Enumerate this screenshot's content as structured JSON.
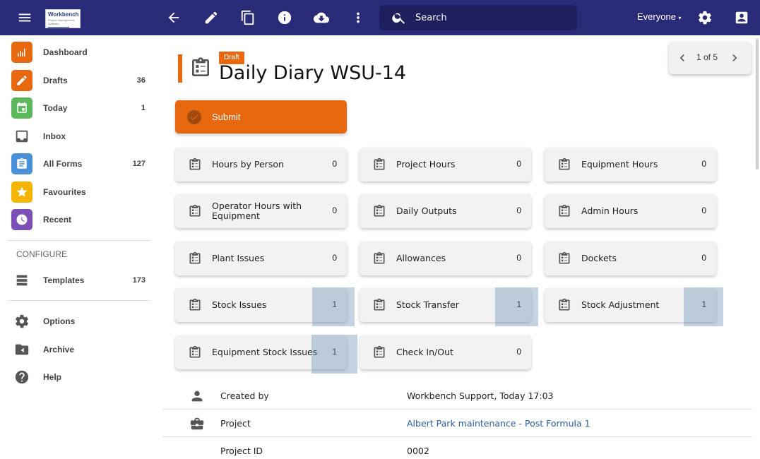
{
  "app": {
    "logo_text": "Workbench",
    "logo_subtext": "Project Management Software"
  },
  "topbar": {
    "search_placeholder": "Search",
    "filter_label": "Everyone"
  },
  "sidebar": {
    "items": [
      {
        "label": "Dashboard",
        "count": "",
        "icon": "dashboard-icon",
        "color": "#e8680f"
      },
      {
        "label": "Drafts",
        "count": "36",
        "icon": "pencil-icon",
        "color": "#e8680f"
      },
      {
        "label": "Today",
        "count": "1",
        "icon": "calendar-icon",
        "color": "#5cb85c"
      },
      {
        "label": "Inbox",
        "count": "",
        "icon": "inbox-icon",
        "color": ""
      },
      {
        "label": "All Forms",
        "count": "127",
        "icon": "clipboard-icon",
        "color": "#4a90d9"
      },
      {
        "label": "Favourites",
        "count": "",
        "icon": "star-icon",
        "color": "#f4b400"
      },
      {
        "label": "Recent",
        "count": "",
        "icon": "clock-icon",
        "color": "#7b4fb5"
      }
    ],
    "configure_label": "CONFIGURE",
    "configure_items": [
      {
        "label": "Templates",
        "count": "173",
        "icon": "templates-icon"
      }
    ],
    "bottom_items": [
      {
        "label": "Options",
        "icon": "gear-icon"
      },
      {
        "label": "Archive",
        "icon": "archive-icon"
      },
      {
        "label": "Help",
        "icon": "help-icon"
      }
    ]
  },
  "form": {
    "status_badge": "Draft",
    "title": "Daily Diary WSU-14",
    "pager_text": "1 of 5",
    "submit_label": "Submit"
  },
  "tiles": [
    {
      "label": "Hours by Person",
      "count": "0",
      "highlighted": false
    },
    {
      "label": "Project Hours",
      "count": "0",
      "highlighted": false
    },
    {
      "label": "Equipment Hours",
      "count": "0",
      "highlighted": false
    },
    {
      "label": "Operator Hours with Equipment",
      "count": "0",
      "highlighted": false
    },
    {
      "label": "Daily Outputs",
      "count": "0",
      "highlighted": false
    },
    {
      "label": "Admin Hours",
      "count": "0",
      "highlighted": false
    },
    {
      "label": "Plant Issues",
      "count": "0",
      "highlighted": false
    },
    {
      "label": "Allowances",
      "count": "0",
      "highlighted": false
    },
    {
      "label": "Dockets",
      "count": "0",
      "highlighted": false
    },
    {
      "label": "Stock Issues",
      "count": "1",
      "highlighted": true
    },
    {
      "label": "Stock Transfer",
      "count": "1",
      "highlighted": true
    },
    {
      "label": "Stock Adjustment",
      "count": "1",
      "highlighted": true
    },
    {
      "label": "Equipment Stock Issues",
      "count": "1",
      "highlighted": true
    },
    {
      "label": "Check In/Out",
      "count": "0",
      "highlighted": false
    }
  ],
  "details": [
    {
      "label": "Created by",
      "value": "Workbench Support, Today 17:03",
      "icon": "person-icon",
      "link": false
    },
    {
      "label": "Project",
      "value": "Albert Park maintenance - Post Formula 1",
      "icon": "briefcase-icon",
      "link": true
    },
    {
      "label": "Project ID",
      "value": "0002",
      "icon": "",
      "link": false
    }
  ],
  "colors": {
    "topbar": "#2a2b78",
    "accent": "#e8680f",
    "link": "#2a5fa8"
  }
}
